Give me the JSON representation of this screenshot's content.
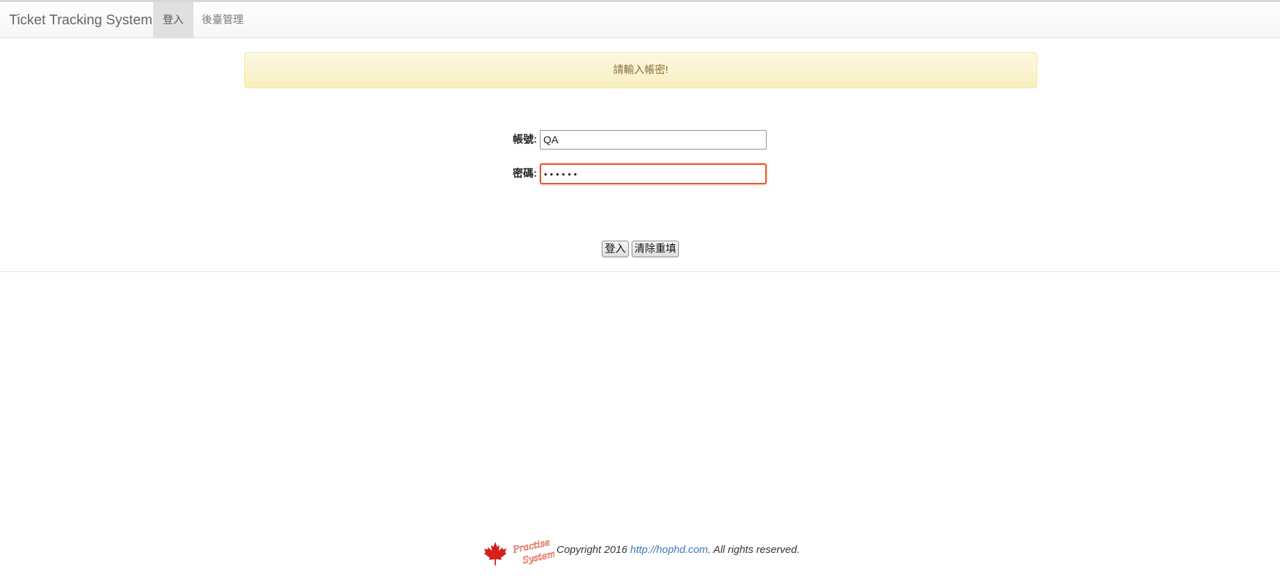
{
  "navbar": {
    "brand": "Ticket Tracking System",
    "items": [
      {
        "label": "登入",
        "active": true
      },
      {
        "label": "後臺管理",
        "active": false
      }
    ]
  },
  "alert": {
    "message": "請輸入帳密!"
  },
  "form": {
    "username_label": "帳號:",
    "username_value": "QA",
    "password_label": "密碼:",
    "password_value": "••••••"
  },
  "buttons": {
    "login": "登入",
    "reset": "清除重填"
  },
  "footer": {
    "logo_text": "Practise System!",
    "copyright_prefix": "Copyright 2016 ",
    "link_text": "http://hophd.com",
    "copyright_suffix": ". All rights reserved."
  },
  "colors": {
    "alert_text": "#8a6d3b",
    "alert_bg": "#fcf8e3",
    "focus_border": "#e0562a",
    "link": "#3a78b8",
    "leaf": "#d81e1e"
  }
}
